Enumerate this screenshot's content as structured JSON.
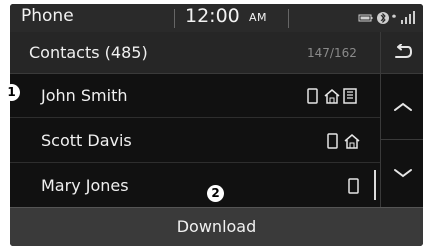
{
  "status_bar": {
    "app_title": "Phone",
    "time": "12:00",
    "ampm": "AM"
  },
  "header": {
    "title": "Contacts (485)",
    "position": "147/162"
  },
  "contacts": [
    {
      "name": "John Smith",
      "numbers": [
        "mobile-icon",
        "home-icon",
        "office-icon"
      ]
    },
    {
      "name": "Scott Davis",
      "numbers": [
        "mobile-icon",
        "home-icon"
      ]
    },
    {
      "name": "Mary Jones",
      "numbers": [
        "mobile-icon"
      ]
    }
  ],
  "callouts": {
    "one": "1",
    "two": "2"
  },
  "download": {
    "label": "Download"
  },
  "colors": {
    "background": "#111111",
    "panel": "#262626",
    "button": "#3a3a3a",
    "text": "#f0f0f0"
  }
}
